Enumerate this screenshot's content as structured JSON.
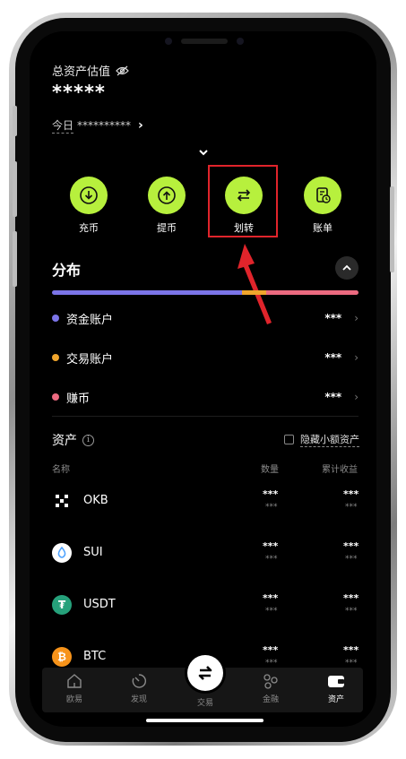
{
  "header": {
    "total_label": "总资产估值",
    "total_value": "*****",
    "today_label": "今日",
    "today_value": "**********",
    "today_chevron": "›"
  },
  "actions": [
    {
      "label": "充币",
      "icon": "download-icon"
    },
    {
      "label": "提币",
      "icon": "upload-icon"
    },
    {
      "label": "划转",
      "icon": "transfer-icon"
    },
    {
      "label": "账单",
      "icon": "bill-icon"
    }
  ],
  "distribution": {
    "title": "分布",
    "bar": [
      {
        "color": "#7b74e8",
        "fraction": 0.62
      },
      {
        "color": "#f0a52c",
        "fraction": 0.08
      },
      {
        "color": "#ec6a80",
        "fraction": 0.3
      }
    ],
    "accounts": [
      {
        "name": "资金账户",
        "value": "***",
        "color": "#7b74e8"
      },
      {
        "name": "交易账户",
        "value": "***",
        "color": "#f0a52c"
      },
      {
        "name": "赚币",
        "value": "***",
        "color": "#ec6a80"
      }
    ]
  },
  "assets": {
    "title": "资产",
    "hide_small_label": "隐藏小额资产",
    "columns": {
      "name": "名称",
      "quantity": "数量",
      "pnl": "累计收益"
    },
    "rows": [
      {
        "symbol": "OKB",
        "quantity": "***",
        "quantity_sub": "***",
        "pnl": "***",
        "pnl_sub": "***",
        "icon": "okb-icon",
        "color": "#000000"
      },
      {
        "symbol": "SUI",
        "quantity": "***",
        "quantity_sub": "***",
        "pnl": "***",
        "pnl_sub": "***",
        "icon": "sui-icon",
        "color": "#ffffff"
      },
      {
        "symbol": "USDT",
        "quantity": "***",
        "quantity_sub": "***",
        "pnl": "***",
        "pnl_sub": "***",
        "icon": "usdt-icon",
        "color": "#26a17b"
      },
      {
        "symbol": "BTC",
        "quantity": "***",
        "quantity_sub": "***",
        "pnl": "***",
        "pnl_sub": "***",
        "icon": "btc-icon",
        "color": "#f7931a"
      }
    ]
  },
  "bottom_nav": [
    {
      "label": "欧易",
      "icon": "home-icon"
    },
    {
      "label": "发现",
      "icon": "discover-icon"
    },
    {
      "label": "交易",
      "icon": "trade-icon"
    },
    {
      "label": "金融",
      "icon": "finance-icon"
    },
    {
      "label": "资产",
      "icon": "wallet-icon",
      "active": true
    }
  ],
  "colors": {
    "accent": "#b7f03d",
    "highlight": "#e0242b"
  }
}
